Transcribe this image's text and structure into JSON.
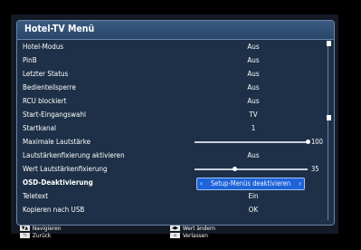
{
  "menu": {
    "title": "Hotel-TV Menü",
    "rows": [
      {
        "label": "Hotel-Modus",
        "value": "Aus"
      },
      {
        "label": "PinB",
        "value": "Aus"
      },
      {
        "label": "Letzter Status",
        "value": "Aus"
      },
      {
        "label": "Bedienteilsperre",
        "value": "Aus"
      },
      {
        "label": "RCU blockiert",
        "value": "Aus"
      },
      {
        "label": "Start-Eingangswahl",
        "value": "TV"
      },
      {
        "label": "Startkanal",
        "value": "1"
      },
      {
        "label": "Maximale Lautstärke",
        "slider_value": "100",
        "level": 1.0
      },
      {
        "label": "Lautstärkenfixierung aktivieren",
        "value": "Aus"
      },
      {
        "label": "Wert Lautstärkenfixierung",
        "slider_value": "35",
        "level": 0.35
      },
      {
        "label": "OSD-Deaktivierung",
        "value": "Setup-Menüs deaktivieren",
        "selected": true
      },
      {
        "label": "Teletext",
        "value": "Ein"
      },
      {
        "label": "Kopieren nach USB",
        "value": "OK"
      }
    ]
  },
  "footer": {
    "navigate": "Navigieren",
    "back": "Zurück",
    "change": "Wert ändern",
    "exit": "Verlassen"
  },
  "icons": {
    "up_down": "▼▲",
    "back": "⮌",
    "left_right": "◀▶",
    "home": "⌂"
  },
  "colors": {
    "menu_bg": "#1d3047",
    "title_bar": "#2f4f74",
    "selection": "#1e63d8"
  }
}
